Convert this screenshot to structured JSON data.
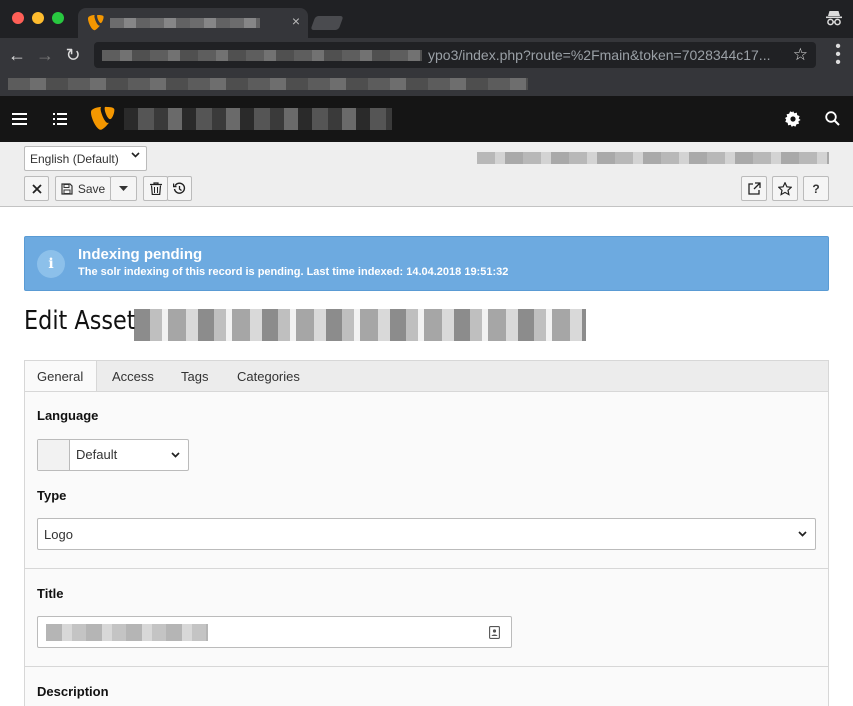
{
  "browser": {
    "tab": {
      "close_glyph": "×"
    },
    "omnibox": {
      "url_visible": "ypo3/index.php?route=%2Fmain&token=7028344c17..."
    },
    "icons": [
      "back-icon",
      "forward-icon",
      "reload-icon",
      "star-icon",
      "menu-icon",
      "incognito-icon"
    ]
  },
  "typo3": {
    "topbar": {
      "icons": [
        "menu-toggle-icon",
        "module-list-icon",
        "typo3-logo-icon",
        "settings-icon",
        "search-icon"
      ]
    },
    "docheader": {
      "language_select": "English (Default)",
      "buttons": {
        "save_label": "Save"
      }
    },
    "alert": {
      "title": "Indexing pending",
      "message": "The solr indexing of this record is pending. Last time indexed: 14.04.2018 19:51:32"
    },
    "page_title": "Edit Asset",
    "tabs": [
      "General",
      "Access",
      "Tags",
      "Categories"
    ],
    "form": {
      "language_label": "Language",
      "language_value": "Default",
      "type_label": "Type",
      "type_value": "Logo",
      "title_label": "Title",
      "description_label": "Description"
    }
  },
  "colors": {
    "typo3_orange": "#f49700",
    "alert_blue": "#6daae0",
    "chrome_dark": "#202124"
  }
}
